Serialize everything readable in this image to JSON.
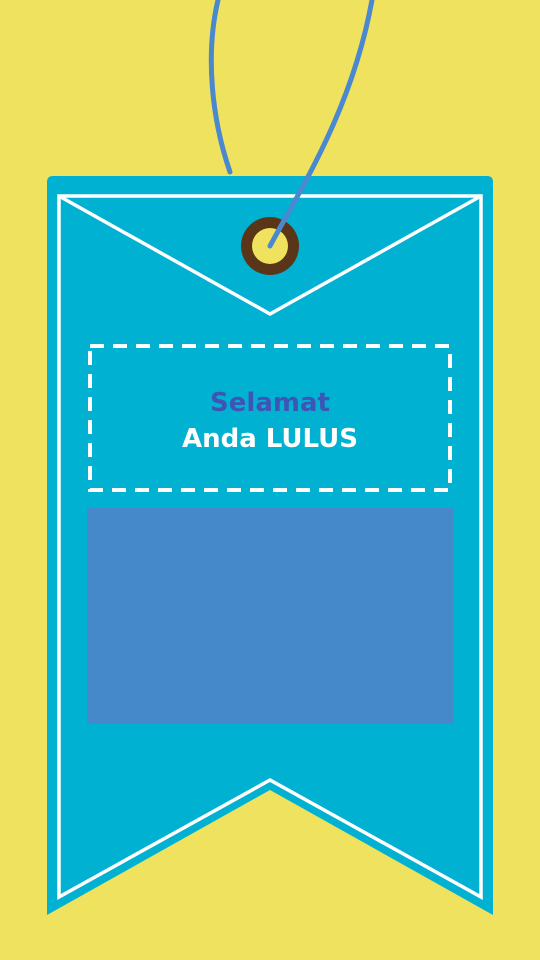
{
  "tag": {
    "greeting": "Selamat",
    "result": "Anda LULUS"
  },
  "colors": {
    "background": "#EFE25E",
    "tag_body": "#00B1D2",
    "string": "#4A88D0",
    "grommet_ring": "#5A3518",
    "grommet_hole": "#EFE25E",
    "photo_panel": "#4589CB",
    "greeting_text": "#3F55B5",
    "result_text": "#FFFFFF"
  },
  "icons": {
    "grommet": "grommet-icon",
    "string": "hanging-string"
  }
}
